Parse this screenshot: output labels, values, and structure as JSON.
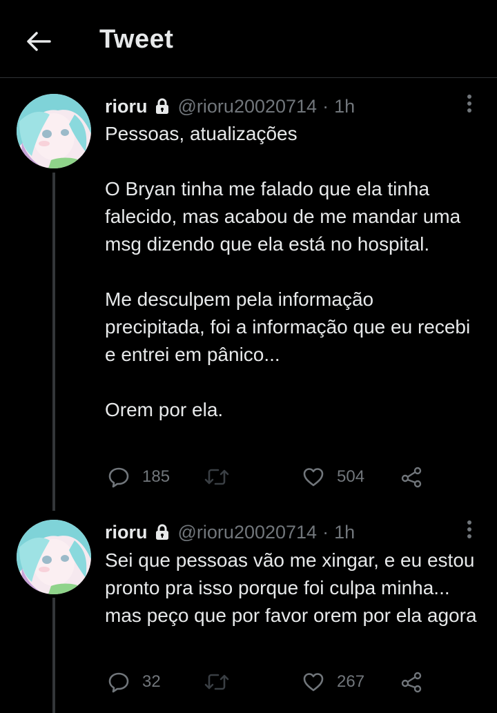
{
  "header": {
    "title": "Tweet"
  },
  "tweets": [
    {
      "author": {
        "name": "rioru",
        "handle": "@rioru20020714",
        "protected": true
      },
      "time": "1h",
      "text": "Pessoas, atualizações\n\nO Bryan tinha me falado que ela tinha falecido, mas acabou de me mandar uma msg dizendo que ela está no hospital.\n\nMe desculpem pela informação precipitada, foi a informação que eu recebi e entrei em pânico...\n\nOrem por ela.",
      "replies": "185",
      "likes": "504"
    },
    {
      "author": {
        "name": "rioru",
        "handle": "@rioru20020714",
        "protected": true
      },
      "time": "1h",
      "text": "Sei que pessoas vão me xingar, e eu estou pronto pra isso porque foi culpa minha... mas peço que por favor orem por ela agora",
      "replies": "32",
      "likes": "267"
    }
  ],
  "colors": {
    "background": "#000000",
    "text": "#e7e9ea",
    "muted": "#71767b",
    "divider": "#2f3336",
    "avatar_hair": "#7fd3d8"
  },
  "icons": [
    "back-arrow-icon",
    "lock-icon",
    "more-icon",
    "reply-icon",
    "retweet-icon",
    "like-icon",
    "share-icon"
  ]
}
